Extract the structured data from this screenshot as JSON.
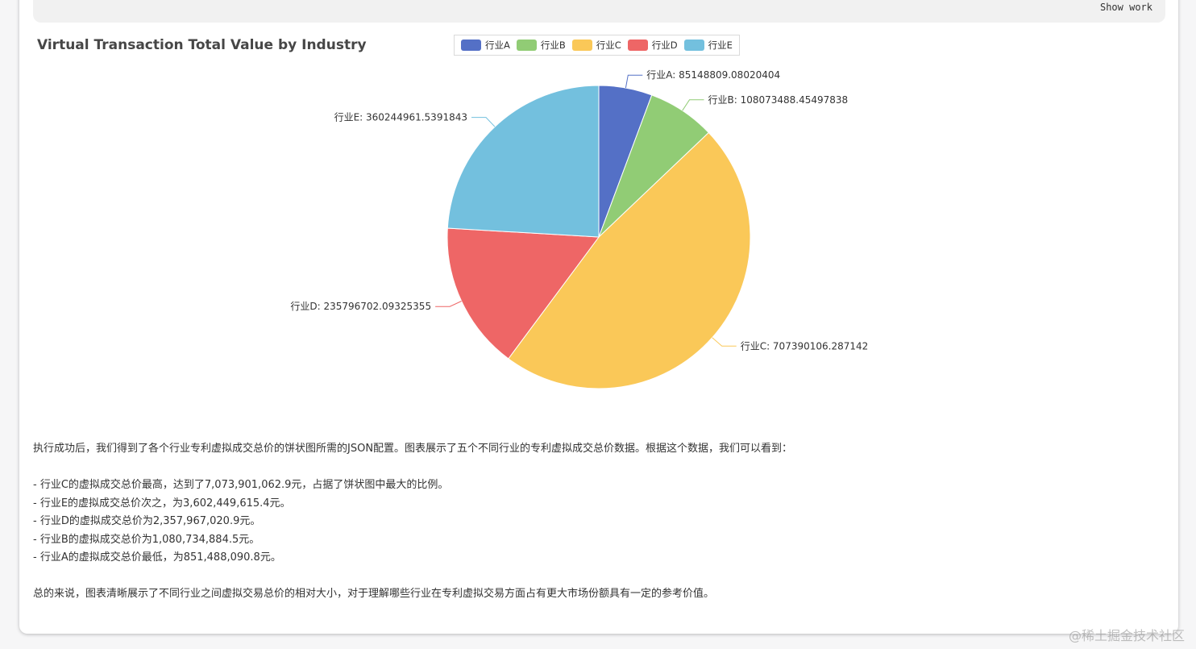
{
  "toolbar": {
    "show_work_label": "Show work"
  },
  "chart_data": {
    "type": "pie",
    "title": "Virtual Transaction Total Value by Industry",
    "legend_position": "top-center",
    "slices": [
      {
        "name": "行业A",
        "value": 85148809.08020404,
        "label": "行业A: 85148809.08020404",
        "color": "#5470c6"
      },
      {
        "name": "行业B",
        "value": 108073488.45497838,
        "label": "行业B: 108073488.45497838",
        "color": "#91cc75"
      },
      {
        "name": "行业C",
        "value": 707390106.287142,
        "label": "行业C: 707390106.287142",
        "color": "#fac858"
      },
      {
        "name": "行业D",
        "value": 235796702.09325355,
        "label": "行业D: 235796702.09325355",
        "color": "#ee6666"
      },
      {
        "name": "行业E",
        "value": 360244961.5391843,
        "label": "行业E: 360244961.5391843",
        "color": "#73c0de"
      }
    ]
  },
  "summary": {
    "intro": "执行成功后，我们得到了各个行业专利虚拟成交总价的饼状图所需的JSON配置。图表展示了五个不同行业的专利虚拟成交总价数据。根据这个数据，我们可以看到：",
    "bullets": [
      "- 行业C的虚拟成交总价最高，达到了7,073,901,062.9元，占据了饼状图中最大的比例。",
      "- 行业E的虚拟成交总价次之，为3,602,449,615.4元。",
      "- 行业D的虚拟成交总价为2,357,967,020.9元。",
      "- 行业B的虚拟成交总价为1,080,734,884.5元。",
      "- 行业A的虚拟成交总价最低，为851,488,090.8元。"
    ],
    "conclusion": "总的来说，图表清晰展示了不同行业之间虚拟交易总价的相对大小，对于理解哪些行业在专利虚拟交易方面占有更大市场份额具有一定的参考价值。"
  },
  "watermark": "@稀土掘金技术社区"
}
